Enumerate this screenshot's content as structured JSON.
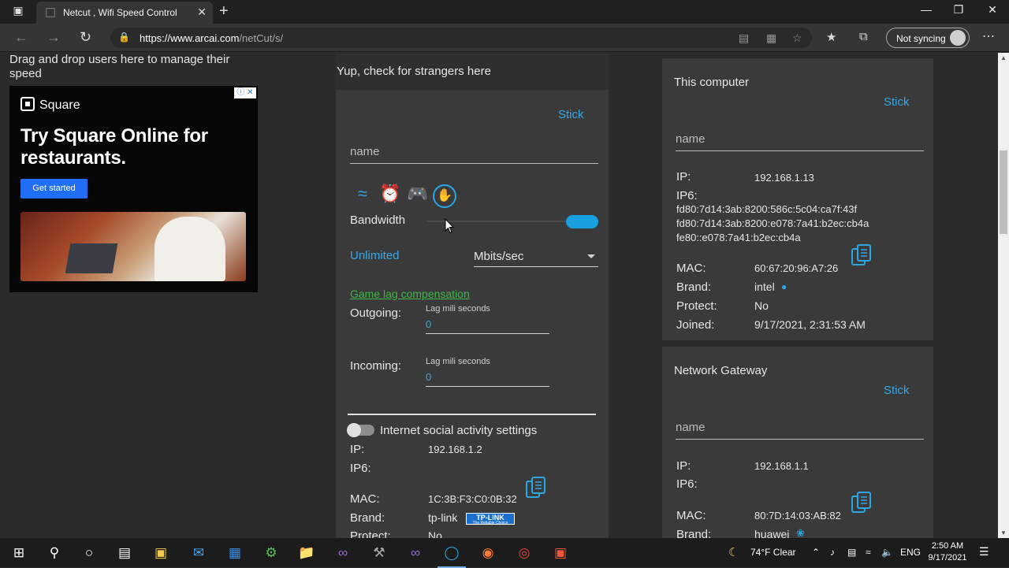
{
  "browser": {
    "tab_title": "Netcut , Wifi Speed Control",
    "url_host": "https://www.arcai.com",
    "url_path": "/netCut/s/",
    "sync_label": "Not syncing"
  },
  "page": {
    "drag_text": "Drag and drop users here to manage their speed",
    "ad": {
      "brand": "Square",
      "headline": "Try Square Online for restaurants.",
      "cta": "Get started"
    },
    "strangers_header": "Yup, check for strangers here",
    "device": {
      "stick": "Stick",
      "name_placeholder": "name",
      "bandwidth_label": "Bandwidth",
      "bandwidth_value": "Unlimited",
      "unit": "Mbits/sec",
      "game_lag": "Game lag compensation",
      "outgoing_label": "Outgoing:",
      "incoming_label": "Incoming:",
      "lag_caption": "Lag mili seconds",
      "outgoing_value": "0",
      "incoming_value": "0",
      "social_label": "Internet social activity settings",
      "ip_key": "IP:",
      "ip": "192.168.1.2",
      "ip6_key": "IP6:",
      "mac_key": "MAC:",
      "mac": "1C:3B:F3:C0:0B:32",
      "brand_key": "Brand:",
      "brand": "tp-link",
      "brand_logo": "TP-LINK",
      "brand_logo_sub": "The Reliable Choice",
      "protect_key": "Protect:",
      "protect": "No"
    },
    "this_computer": {
      "title": "This computer",
      "stick": "Stick",
      "name_placeholder": "name",
      "ip_key": "IP:",
      "ip": "192.168.1.13",
      "ip6_key": "IP6:",
      "ip6_lines": [
        "fd80:7d14:3ab:8200:586c:5c04:ca7f:43f",
        "fd80:7d14:3ab:8200:e078:7a41:b2ec:cb4a",
        "fe80::e078:7a41:b2ec:cb4a"
      ],
      "mac_key": "MAC:",
      "mac": "60:67:20:96:A7:26",
      "brand_key": "Brand:",
      "brand": "intel",
      "protect_key": "Protect:",
      "protect": "No",
      "joined_key": "Joined:",
      "joined": "9/17/2021, 2:31:53 AM"
    },
    "gateway": {
      "title": "Network Gateway",
      "stick": "Stick",
      "name_placeholder": "name",
      "ip_key": "IP:",
      "ip": "192.168.1.1",
      "ip6_key": "IP6:",
      "mac_key": "MAC:",
      "mac": "80:7D:14:03:AB:82",
      "brand_key": "Brand:",
      "brand": "huawei"
    }
  },
  "taskbar": {
    "weather": "74°F  Clear",
    "lang": "ENG",
    "time": "2:50 AM",
    "date": "9/17/2021"
  },
  "colors": {
    "accent_blue": "#37a7e6",
    "link_green": "#3fb54a",
    "panel": "#3a3a3a",
    "background": "#2b2b2b"
  }
}
